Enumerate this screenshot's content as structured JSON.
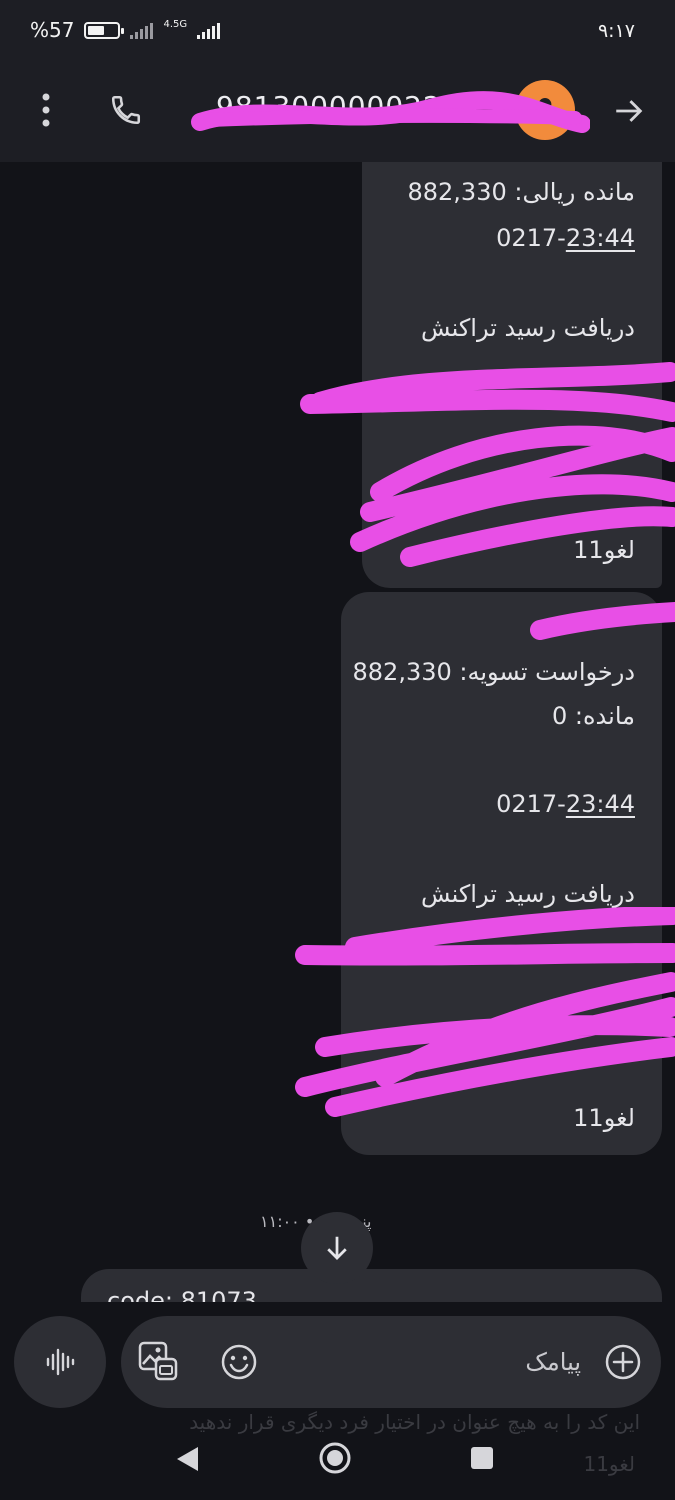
{
  "status_bar": {
    "battery_text": "%57",
    "battery_level": 0.57,
    "network": "4.5G",
    "time": "۹:۱۷"
  },
  "header": {
    "contact_number": "98130000002255",
    "icons": [
      "more-vert-icon",
      "phone-icon",
      "avatar-icon",
      "arrow-forward-icon"
    ],
    "avatar_color": "#f28b3c"
  },
  "messages": [
    {
      "lines": [
        "مانده ریالی: 882,330",
        "0217-23:44",
        "دریافت رسید تراکنش",
        "لغو11"
      ],
      "time_underlined": "23:44"
    },
    {
      "lines": [
        "درخواست تسویه: 882,330",
        "مانده: 0",
        "0217-23:44",
        "دریافت رسید تراکنش",
        "لغو11"
      ],
      "time_underlined": "23:44"
    }
  ],
  "date_separator": "پنجشنبه • ۱۱:۰۰",
  "incoming_message": {
    "text": "code: 81073",
    "behind_lines": [
      "این کد را به هیچ عنوان در اختیار فرد دیگری قرار ندهید",
      "لغو11"
    ]
  },
  "composer": {
    "placeholder": "پیامک",
    "icons": [
      "voice-icon",
      "gallery-icon",
      "emoji-icon",
      "plus-icon"
    ]
  },
  "colors": {
    "background": "#121318",
    "bar": "#1d1e24",
    "bubble": "#2d2e34",
    "redaction": "#e84fe6"
  },
  "nav_icons": [
    "back-icon",
    "home-icon",
    "recents-icon"
  ]
}
